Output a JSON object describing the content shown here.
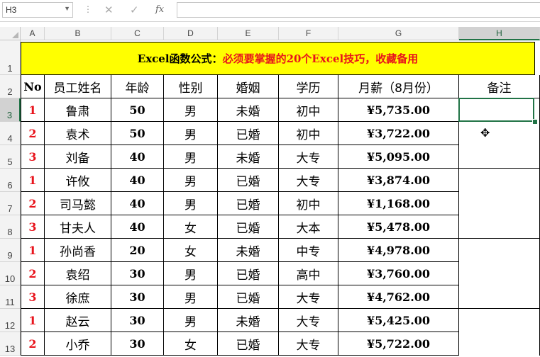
{
  "formula_bar": {
    "name_box": "H3",
    "fx": "fx",
    "formula": ""
  },
  "columns": [
    "A",
    "B",
    "C",
    "D",
    "E",
    "F",
    "G",
    "H"
  ],
  "rows": [
    "1",
    "2",
    "3",
    "4",
    "5",
    "6",
    "7",
    "8",
    "9",
    "10",
    "11",
    "12",
    "13"
  ],
  "title": {
    "black": "Excel函数公式：",
    "red": "必须要掌握的20个Excel技巧，收藏备用"
  },
  "headers": [
    "No",
    "员工姓名",
    "年龄",
    "性别",
    "婚姻",
    "学历",
    "月薪（8月份）",
    "备注"
  ],
  "records": [
    {
      "no": "1",
      "name": "鲁肃",
      "age": "50",
      "gender": "男",
      "marriage": "未婚",
      "edu": "初中",
      "salary": "¥5,735.00"
    },
    {
      "no": "2",
      "name": "袁术",
      "age": "50",
      "gender": "男",
      "marriage": "已婚",
      "edu": "初中",
      "salary": "¥3,722.00"
    },
    {
      "no": "3",
      "name": "刘备",
      "age": "40",
      "gender": "男",
      "marriage": "未婚",
      "edu": "大专",
      "salary": "¥5,095.00"
    },
    {
      "no": "1",
      "name": "许攸",
      "age": "40",
      "gender": "男",
      "marriage": "已婚",
      "edu": "大专",
      "salary": "¥3,874.00"
    },
    {
      "no": "2",
      "name": "司马懿",
      "age": "40",
      "gender": "男",
      "marriage": "已婚",
      "edu": "初中",
      "salary": "¥1,168.00"
    },
    {
      "no": "3",
      "name": "甘夫人",
      "age": "40",
      "gender": "女",
      "marriage": "已婚",
      "edu": "大本",
      "salary": "¥5,478.00"
    },
    {
      "no": "1",
      "name": "孙尚香",
      "age": "20",
      "gender": "女",
      "marriage": "未婚",
      "edu": "中专",
      "salary": "¥4,978.00"
    },
    {
      "no": "2",
      "name": "袁绍",
      "age": "30",
      "gender": "男",
      "marriage": "已婚",
      "edu": "高中",
      "salary": "¥3,760.00"
    },
    {
      "no": "3",
      "name": "徐庶",
      "age": "30",
      "gender": "男",
      "marriage": "已婚",
      "edu": "大专",
      "salary": "¥4,762.00"
    },
    {
      "no": "1",
      "name": "赵云",
      "age": "30",
      "gender": "男",
      "marriage": "未婚",
      "edu": "大专",
      "salary": "¥5,425.00"
    },
    {
      "no": "2",
      "name": "小乔",
      "age": "30",
      "gender": "女",
      "marriage": "已婚",
      "edu": "大专",
      "salary": "¥5,722.00"
    }
  ],
  "colors": {
    "title_bg": "#ffff00",
    "accent_red": "#e8141c",
    "selection": "#217346"
  }
}
